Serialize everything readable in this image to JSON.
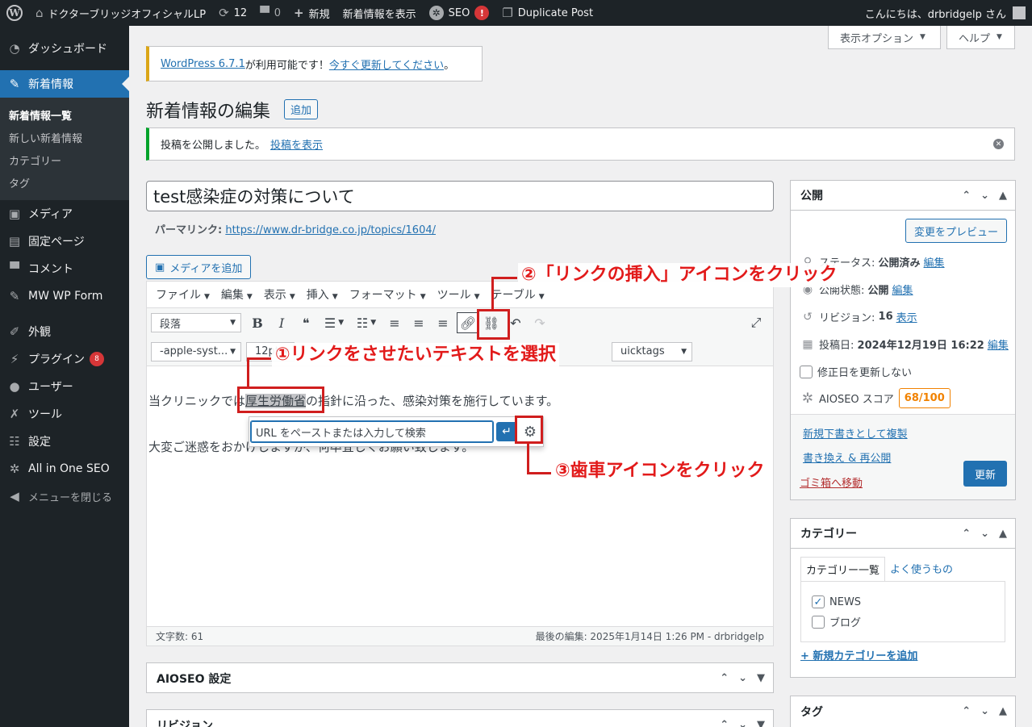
{
  "adminbar": {
    "site_name": "ドクターブリッジオフィシャルLP",
    "updates_count": "12",
    "comments_count": "0",
    "new_label": "新規",
    "view_label": "新着情報を表示",
    "seo_label": "SEO",
    "seo_badge": "!",
    "duplicate_label": "Duplicate Post",
    "howdy": "こんにちは、drbridgelp さん"
  },
  "sidebar": {
    "dashboard": "ダッシュボード",
    "news": "新着情報",
    "submenu": [
      "新着情報一覧",
      "新しい新着情報",
      "カテゴリー",
      "タグ"
    ],
    "media": "メディア",
    "pages": "固定ページ",
    "comments": "コメント",
    "mwform": "MW WP Form",
    "appearance": "外観",
    "plugins": "プラグイン",
    "plugins_badge": "8",
    "users": "ユーザー",
    "tools": "ツール",
    "settings": "設定",
    "aioseo": "All in One SEO",
    "collapse": "メニューを閉じる"
  },
  "screen_options": "表示オプション",
  "help": "ヘルプ",
  "notice": {
    "wp_link": "WordPress 6.7.1",
    "mid": " が利用可能です！",
    "update_link": "今すぐ更新してください",
    "end": "。"
  },
  "page_title": "新着情報の編集",
  "add_new": "追加",
  "published_notice": {
    "text": "投稿を公開しました。",
    "link": "投稿を表示"
  },
  "post_title": "test感染症の対策について",
  "permalink": {
    "label": "パーマリンク:",
    "url": "https://www.dr-bridge.co.jp/topics/1604/"
  },
  "add_media": "メディアを追加",
  "editor": {
    "menubar": [
      "ファイル",
      "編集",
      "表示",
      "挿入",
      "フォーマット",
      "ツール",
      "テーブル"
    ],
    "format_select": "段落",
    "font_select": "-apple-syst...",
    "size_select": "12pt",
    "quicktags_select": "uicktags",
    "para1_before": "当クリニックでは",
    "para1_highlight": "厚生労働省",
    "para1_after": "の指針に沿った、感染対策を施行しています。",
    "para2": "大変ご迷惑をおかけしますが、何卒宜しくお願い致します。",
    "link_placeholder": "URL をペーストまたは入力して検索",
    "word_count": "文字数: 61",
    "last_edited": "最後の編集: 2025年1月14日 1:26 PM - drbridgelp"
  },
  "annotations": {
    "step1": "①リンクをさせたいテキストを選択",
    "step2": "②「リンクの挿入」アイコンをクリック",
    "step3": "③歯車アイコンをクリック",
    "color": "#d01e1e"
  },
  "publish": {
    "title": "公開",
    "preview": "変更をプレビュー",
    "status_label": "ステータス:",
    "status_value": "公開済み",
    "visibility_label": "公開状態:",
    "visibility_value": "公開",
    "revisions_label": "リビジョン:",
    "revisions_value": "16",
    "revisions_link": "表示",
    "date_label": "投稿日:",
    "date_value": "2024年12月19日 16:22",
    "edit": "編集",
    "no_update_mod": "修正日を更新しない",
    "aioseo_label": "AIOSEO スコア",
    "aioseo_score": "68/100",
    "copy_draft": "新規下書きとして複製",
    "rewrite": "書き換え & 再公開",
    "trash": "ゴミ箱へ移動",
    "update": "更新"
  },
  "categories": {
    "title": "カテゴリー",
    "tab_all": "カテゴリー一覧",
    "tab_popular": "よく使うもの",
    "items": [
      {
        "label": "NEWS",
        "checked": true
      },
      {
        "label": "ブログ",
        "checked": false
      }
    ],
    "add_new": "+ 新規カテゴリーを追加"
  },
  "tags_box": {
    "title": "タグ"
  },
  "aioseo_box": {
    "title": "AIOSEO 設定"
  },
  "revisions_box": {
    "title": "リビジョン"
  },
  "colors": {
    "admin_dark": "#1d2327",
    "accent": "#2271b1",
    "success": "#00a32a",
    "warning": "#dba617",
    "danger": "#d63638"
  }
}
